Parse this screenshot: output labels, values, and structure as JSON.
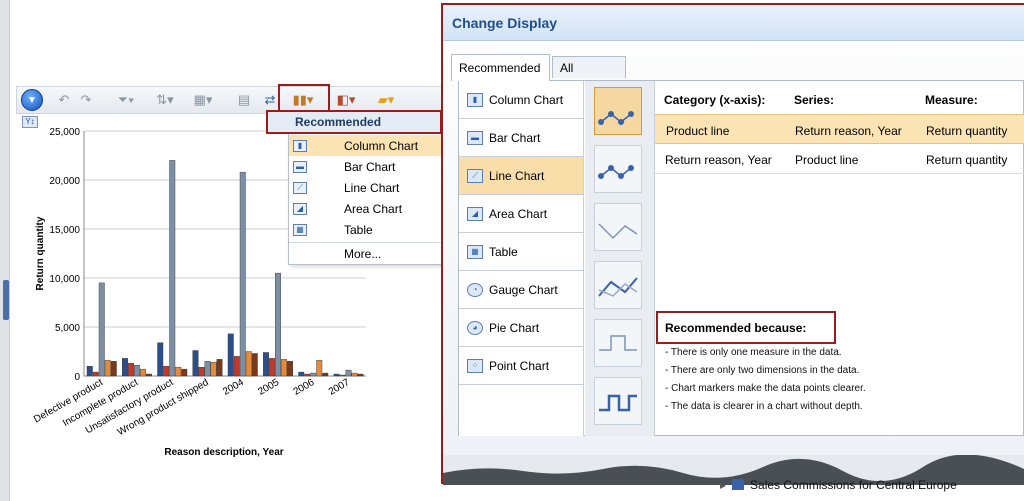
{
  "toolbar": {
    "buttons": [
      "back-circle",
      "undo",
      "redo",
      "filter",
      "sort",
      "layout",
      "grid",
      "refresh",
      "chart-type",
      "color-theme",
      "highlight"
    ]
  },
  "chart_data": {
    "type": "bar",
    "title": "",
    "xlabel": "Reason description, Year",
    "ylabel": "Return quantity",
    "ylim": [
      0,
      25000
    ],
    "yticks": [
      "0",
      "5,000",
      "10,000",
      "15,000",
      "20,000",
      "25,000"
    ],
    "categories": [
      "Defective product",
      "Incomplete product",
      "Unsatisfactory product",
      "Wrong product shipped",
      "2004",
      "2005",
      "2006",
      "2007"
    ],
    "series": [
      {
        "color": "#2c4f8c",
        "values": [
          1000,
          1800,
          3400,
          2600,
          4300,
          2400,
          400,
          200
        ]
      },
      {
        "color": "#c0392b",
        "values": [
          400,
          1300,
          1000,
          900,
          2000,
          1800,
          200,
          100
        ]
      },
      {
        "color": "#7d8fa3",
        "values": [
          9500,
          1100,
          22000,
          1500,
          20800,
          10500,
          300,
          600
        ]
      },
      {
        "color": "#e58a3a",
        "values": [
          1600,
          700,
          900,
          1400,
          2500,
          1700,
          1600,
          300
        ]
      },
      {
        "color": "#7a3a1a",
        "values": [
          1500,
          200,
          700,
          1700,
          2300,
          1500,
          300,
          200
        ]
      }
    ]
  },
  "dropdown": {
    "header": "Recommended",
    "items": [
      {
        "label": "Column Chart",
        "icon": "column-chart-icon"
      },
      {
        "label": "Bar Chart",
        "icon": "bar-chart-icon"
      },
      {
        "label": "Line Chart",
        "icon": "line-chart-icon"
      },
      {
        "label": "Area Chart",
        "icon": "area-chart-icon"
      },
      {
        "label": "Table",
        "icon": "table-icon"
      }
    ],
    "more": "More..."
  },
  "dialog": {
    "title": "Change Display",
    "tabs": [
      "Recommended",
      "All"
    ],
    "chart_types": [
      {
        "label": "Column Chart",
        "icon": "column-chart-icon"
      },
      {
        "label": "Bar Chart",
        "icon": "bar-chart-icon"
      },
      {
        "label": "Line Chart",
        "icon": "line-chart-icon"
      },
      {
        "label": "Area Chart",
        "icon": "area-chart-icon"
      },
      {
        "label": "Table",
        "icon": "table-icon"
      },
      {
        "label": "Gauge Chart",
        "icon": "gauge-chart-icon"
      },
      {
        "label": "Pie Chart",
        "icon": "pie-chart-icon"
      },
      {
        "label": "Point Chart",
        "icon": "point-chart-icon"
      }
    ],
    "table": {
      "headers": [
        "Category (x-axis):",
        "Series:",
        "Measure:"
      ],
      "rows": [
        [
          "Product line",
          "Return reason, Year",
          "Return quantity"
        ],
        [
          "Return reason, Year",
          "Product line",
          "Return quantity"
        ]
      ]
    },
    "recommended_title": "Recommended because:",
    "reasons": [
      "- There is only one measure in the data.",
      "- There are only two dimensions in the data.",
      "- Chart markers make the data points clearer.",
      "- The data is clearer in a chart without depth."
    ]
  },
  "bottom": {
    "item": "Sales Commissions for Central Europe"
  }
}
